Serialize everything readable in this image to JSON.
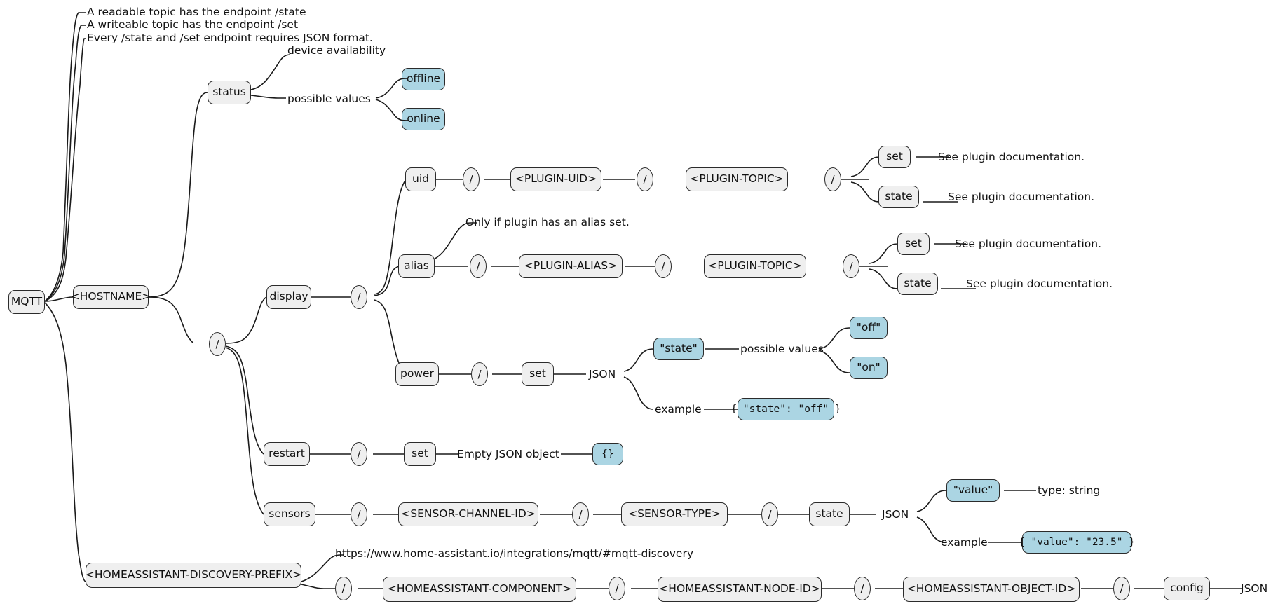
{
  "diagram": {
    "title": "MQTT topic tree",
    "type": "mind-map",
    "colors": {
      "node_fill": "#efefef",
      "highlight_fill": "#abd5e3",
      "stroke": "#2b2b2b",
      "text": "#111111",
      "background": "#ffffff"
    }
  },
  "nodes": {
    "root": "MQTT",
    "hostname": "<HOSTNAME>",
    "slash_root": "/",
    "status": "status",
    "status_note_availability": "device availability",
    "status_note_possible_values": "possible values",
    "status_value_offline": "offline",
    "status_value_online": "online",
    "root_notes": [
      "A readable topic has the endpoint /state",
      "A writeable topic has the endpoint /set",
      "Every /state and /set endpoint requires JSON format."
    ],
    "display": "display",
    "display_slash": "/",
    "uid": "uid",
    "uid_slash_1": "/",
    "plugin_uid": "<PLUGIN-UID>",
    "uid_slash_2": "/",
    "uid_plugin_topic": "<PLUGIN-TOPIC>",
    "uid_slash_3": "/",
    "uid_set": "set",
    "uid_set_note": "See plugin documentation.",
    "uid_state": "state",
    "uid_state_note": "See plugin documentation.",
    "alias": "alias",
    "alias_note": "Only if plugin has an alias set.",
    "alias_slash_1": "/",
    "plugin_alias": "<PLUGIN-ALIAS>",
    "alias_slash_2": "/",
    "alias_plugin_topic": "<PLUGIN-TOPIC>",
    "alias_slash_3": "/",
    "alias_set": "set",
    "alias_set_note": "See plugin documentation.",
    "alias_state": "state",
    "alias_state_note": "See plugin documentation.",
    "power": "power",
    "power_slash": "/",
    "power_set": "set",
    "power_json": "JSON",
    "power_state_key": "\"state\"",
    "power_possible_values": "possible values",
    "power_value_off": "\"off\"",
    "power_value_on": "\"on\"",
    "power_example_label": "example",
    "power_example_value": "{ \"state\": \"off\" }",
    "restart": "restart",
    "restart_slash": "/",
    "restart_set": "set",
    "restart_note": "Empty JSON object",
    "restart_value": "{}",
    "sensors": "sensors",
    "sensors_slash_1": "/",
    "sensor_channel_id": "<SENSOR-CHANNEL-ID>",
    "sensors_slash_2": "/",
    "sensor_type": "<SENSOR-TYPE>",
    "sensors_slash_3": "/",
    "sensors_state": "state",
    "sensors_json": "JSON",
    "sensors_value_key": "\"value\"",
    "sensors_value_type": "type: string",
    "sensors_example_label": "example",
    "sensors_example_value": "{ \"value\": \"23.5\" }",
    "ha_discovery_prefix": "<HOMEASSISTANT-DISCOVERY-PREFIX>",
    "ha_doc_url": "https://www.home-assistant.io/integrations/mqtt/#mqtt-discovery",
    "ha_slash_1": "/",
    "ha_component": "<HOMEASSISTANT-COMPONENT>",
    "ha_slash_2": "/",
    "ha_node_id": "<HOMEASSISTANT-NODE-ID>",
    "ha_slash_3": "/",
    "ha_object_id": "<HOMEASSISTANT-OBJECT-ID>",
    "ha_slash_4": "/",
    "ha_config": "config",
    "ha_json": "JSON"
  }
}
